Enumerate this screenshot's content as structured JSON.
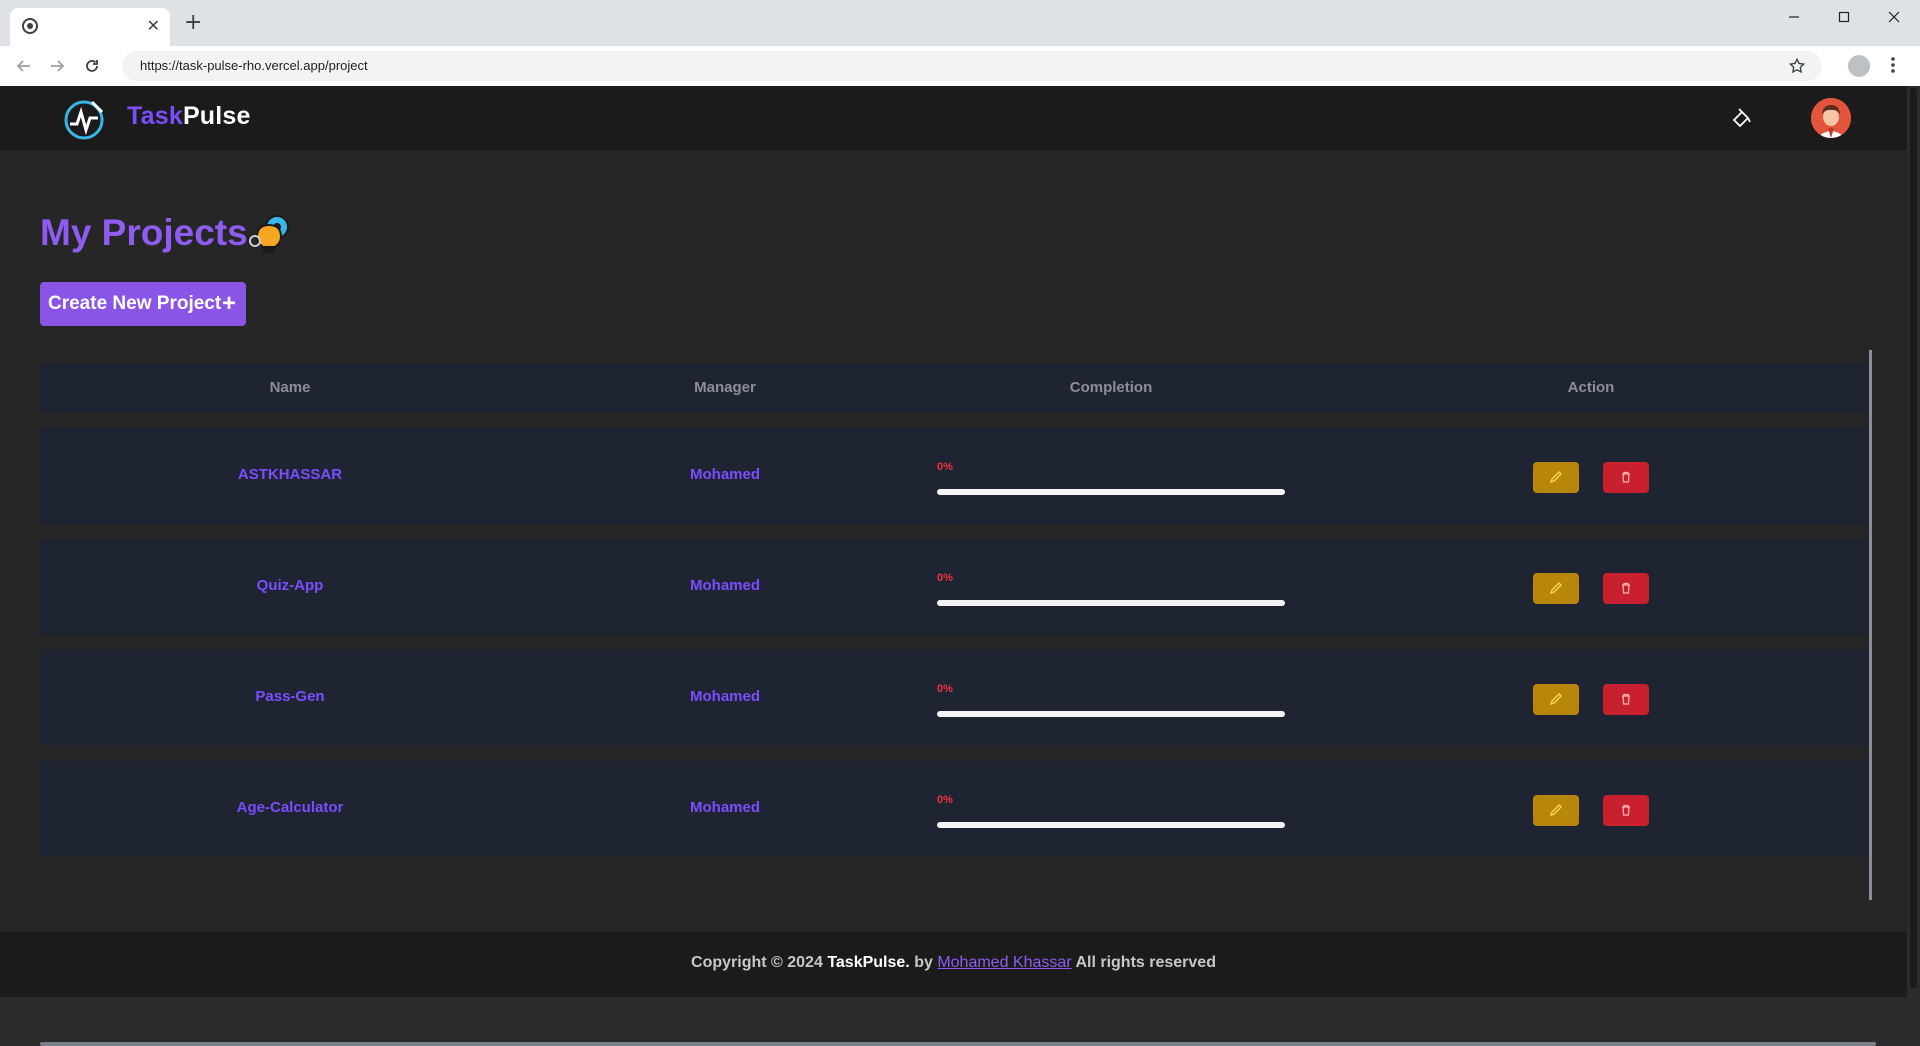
{
  "browser": {
    "tab_title": "",
    "url": "https://task-pulse-rho.vercel.app/project"
  },
  "header": {
    "brand_part1": "Task",
    "brand_part2": "Pulse"
  },
  "page": {
    "title": "My Projects",
    "create_button": "Create New Project"
  },
  "table": {
    "columns": [
      "Name",
      "Manager",
      "Completion",
      "Action"
    ],
    "rows": [
      {
        "name": "ASTKHASSAR",
        "manager": "Mohamed",
        "completion": "0%",
        "progress": 0
      },
      {
        "name": "Quiz-App",
        "manager": "Mohamed",
        "completion": "0%",
        "progress": 0
      },
      {
        "name": "Pass-Gen",
        "manager": "Mohamed",
        "completion": "0%",
        "progress": 0
      },
      {
        "name": "Age-Calculator",
        "manager": "Mohamed",
        "completion": "0%",
        "progress": 0
      }
    ]
  },
  "footer": {
    "copyright": "Copyright © 2024",
    "brand": "TaskPulse.",
    "by": "by",
    "author": "Mohamed Khassar",
    "rights": "All rights reserved"
  },
  "colors": {
    "accent": "#7c4dff",
    "edit": "#b8860b",
    "delete": "#c8202f",
    "progress_text": "#ef3340"
  }
}
